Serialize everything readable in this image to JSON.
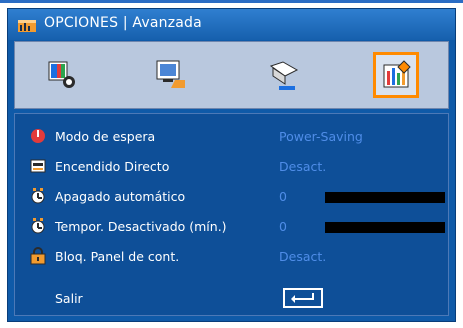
{
  "window": {
    "title": "OPCIONES | Avanzada"
  },
  "tabs": [
    {
      "name": "image-settings",
      "icon": "image-settings-icon",
      "active": false
    },
    {
      "name": "screen-settings",
      "icon": "screen-settings-icon",
      "active": false
    },
    {
      "name": "setup",
      "icon": "setup-icon",
      "active": false
    },
    {
      "name": "options",
      "icon": "options-icon",
      "active": true
    }
  ],
  "rows": [
    {
      "label": "Modo de espera",
      "value": "Power-Saving",
      "icon": "standby-icon"
    },
    {
      "label": "Encendido Directo",
      "value": "Desact.",
      "icon": "direct-power-on-icon"
    },
    {
      "label": "Apagado automático",
      "value": "0",
      "icon": "auto-power-off-icon",
      "level": 0
    },
    {
      "label": "Tempor. Desactivado (mín.)",
      "value": "0",
      "icon": "sleep-timer-icon",
      "level": 0
    },
    {
      "label": "Bloq. Panel de cont.",
      "value": "Desact.",
      "icon": "keypad-lock-icon"
    }
  ],
  "exit": {
    "label": "Salir",
    "icon": "enter-key-icon"
  },
  "colors": {
    "window_bg": "#0f5aa8",
    "accent": "#ff8a00",
    "value_text": "#4f8de8"
  }
}
